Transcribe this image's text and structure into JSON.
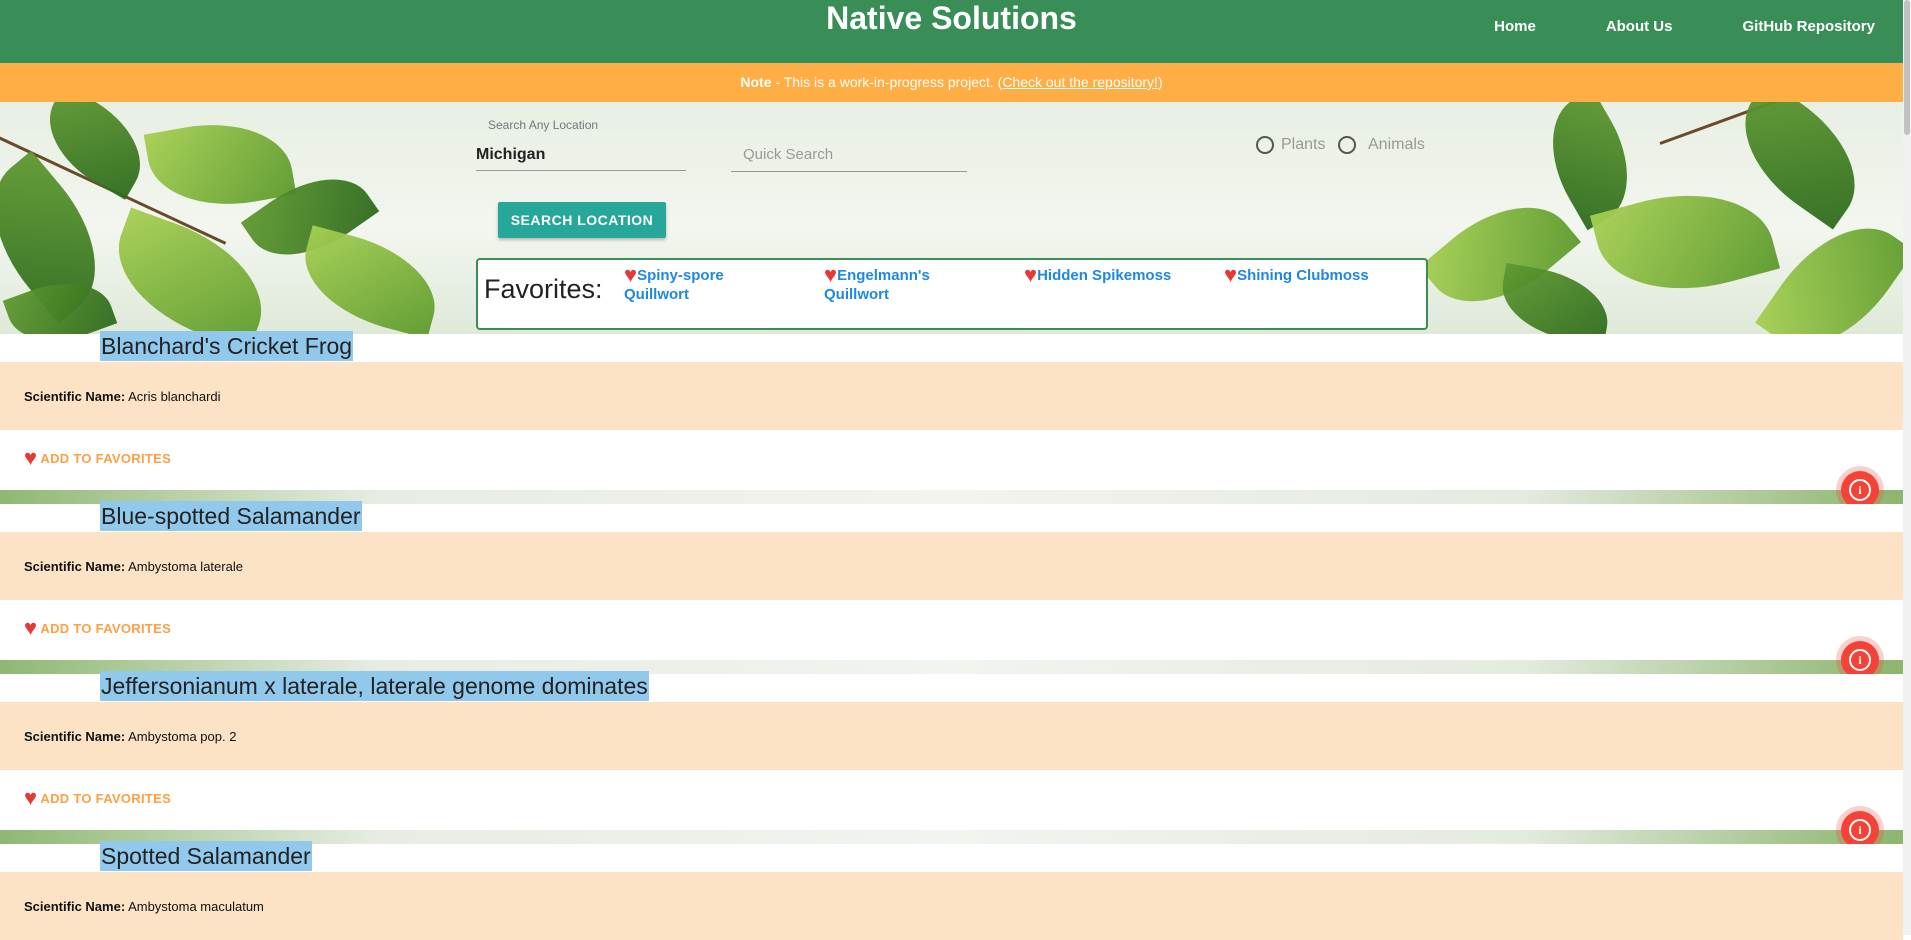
{
  "header": {
    "title": "Native Solutions",
    "nav": [
      "Home",
      "About Us",
      "GitHub Repository"
    ]
  },
  "note": {
    "label": "Note",
    "text": " - This is a work-in-progress project. (",
    "link": "Check out the repository!",
    "close": ")"
  },
  "search": {
    "location_label": "Search Any Location",
    "location_value": "Michigan",
    "quick_placeholder": "Quick Search",
    "radio_plants": "Plants",
    "radio_animals": "Animals",
    "button": "SEARCH LOCATION"
  },
  "favorites": {
    "title": "Favorites:",
    "items": [
      "Spiny-spore Quillwort",
      "Engelmann's Quillwort",
      "Hidden Spikemoss",
      "Shining Clubmoss"
    ]
  },
  "results": [
    {
      "name": "Blanchard's Cricket Frog",
      "sci_label": "Scientific Name:",
      "sci": "Acris blanchardi",
      "fav": "ADD TO FAVORITES"
    },
    {
      "name": "Blue-spotted Salamander",
      "sci_label": "Scientific Name:",
      "sci": "Ambystoma laterale",
      "fav": "ADD TO FAVORITES"
    },
    {
      "name": "Jeffersonianum x laterale, laterale genome dominates",
      "sci_label": "Scientific Name:",
      "sci": "Ambystoma pop. 2",
      "fav": "ADD TO FAVORITES"
    },
    {
      "name": "Spotted Salamander",
      "sci_label": "Scientific Name:",
      "sci": "Ambystoma maculatum",
      "fav": "ADD TO FAVORITES"
    }
  ],
  "colors": {
    "header": "#388e56",
    "note": "#ffad45",
    "accent": "#27a69a",
    "info": "#f44336"
  },
  "icons": {
    "heart": "heart-icon",
    "info": "info-icon"
  }
}
